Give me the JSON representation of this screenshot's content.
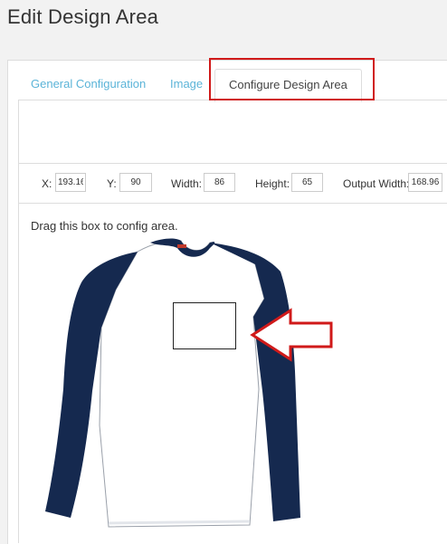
{
  "page": {
    "title": "Edit Design Area"
  },
  "tabs": [
    {
      "label": "General Configuration"
    },
    {
      "label": "Image"
    },
    {
      "label": "Configure Design Area"
    }
  ],
  "coords": {
    "x_label": "X:",
    "x_value": "193.16",
    "y_label": "Y:",
    "y_value": "90",
    "width_label": "Width:",
    "width_value": "86",
    "height_label": "Height:",
    "height_value": "65",
    "output_width_label": "Output Width:",
    "output_width_value": "168.96"
  },
  "instruction": "Drag this box to config area.",
  "colors": {
    "shirt_body": "#ffffff",
    "shirt_sleeves": "#15294f",
    "tab_link": "#5bb4d8",
    "highlight": "#d01a1a"
  },
  "icons": {
    "callout": "arrow-left-outline-icon"
  }
}
